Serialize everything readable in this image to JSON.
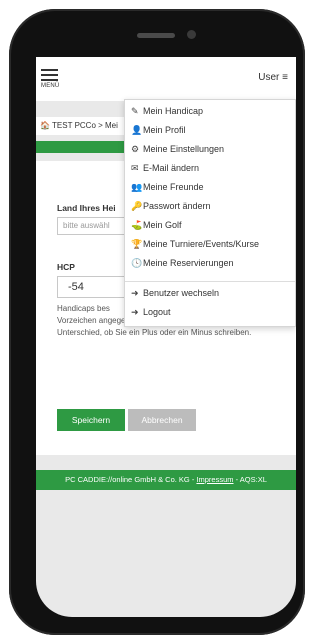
{
  "header": {
    "menu_label": "MENÜ",
    "user_label": "User ≡"
  },
  "breadcrumb": {
    "text": "🏠 TEST PCCo > Mei",
    "right_text": "ten"
  },
  "form": {
    "country_label": "Land Ihres Hei",
    "country_placeholder": "bitte auswähl",
    "hcp_label": "HCP",
    "hcp_value": "-54",
    "help_line1": "Handicaps bes",
    "help_rest": "Vorzeichen angegeben werden. Dabei macht es keinen Unterschied, ob Sie ein Plus oder ein Minus schreiben.",
    "save_label": "Speichern",
    "cancel_label": "Abbrechen"
  },
  "footer": {
    "company": "PC CADDIE://online GmbH & Co. KG - ",
    "imprint": "Impressum",
    "suffix": " - AQS:XL"
  },
  "dropdown": {
    "items": [
      {
        "icon": "✎",
        "label": "Mein Handicap"
      },
      {
        "icon": "👤",
        "label": "Mein Profil"
      },
      {
        "icon": "⚙",
        "label": "Meine Einstellungen"
      },
      {
        "icon": "✉",
        "label": "E-Mail ändern"
      },
      {
        "icon": "👥",
        "label": "Meine Freunde"
      },
      {
        "icon": "🔑",
        "label": "Passwort ändern"
      },
      {
        "icon": "⛳",
        "label": "Mein Golf"
      },
      {
        "icon": "🏆",
        "label": "Meine Turniere/Events/Kurse"
      },
      {
        "icon": "🕓",
        "label": "Meine Reservierungen"
      },
      {
        "icon": "➜",
        "label": "Benutzer wechseln"
      },
      {
        "icon": "➜",
        "label": "Logout"
      }
    ]
  },
  "colors": {
    "accent": "#2e9a43",
    "cancel": "#bcbcbc",
    "background": "#e9e9e9"
  }
}
